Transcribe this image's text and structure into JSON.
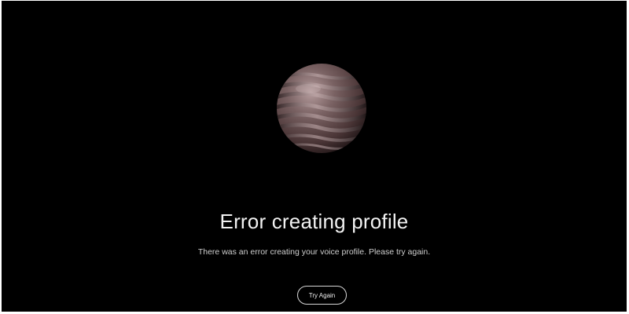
{
  "error": {
    "title": "Error creating profile",
    "message": "There was an error creating your voice profile. Please try again."
  },
  "actions": {
    "retry_label": "Try Again"
  },
  "colors": {
    "background": "#000000",
    "orb": "#6b5657",
    "text": "#f2f2f2",
    "button_border": "#d8d8d8"
  },
  "icons": {
    "visual": "voice-orb-icon"
  }
}
